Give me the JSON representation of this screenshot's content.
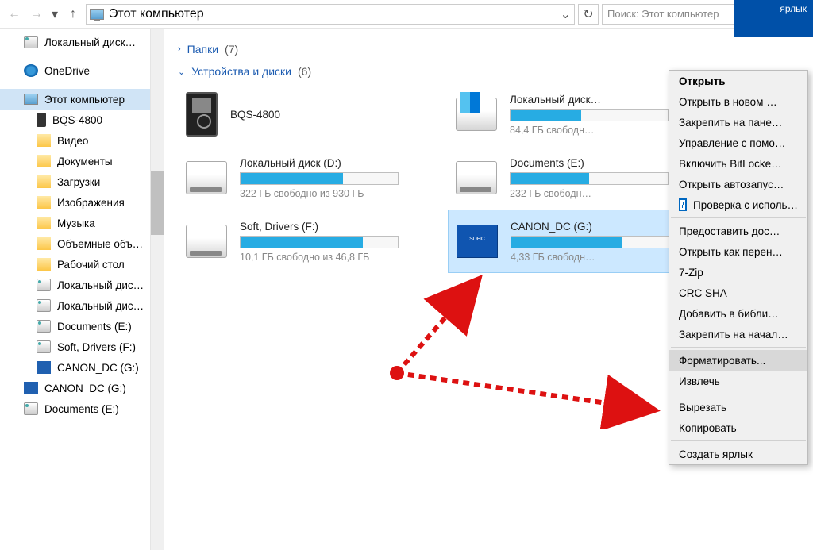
{
  "toolbar": {
    "address": "Этот компьютер",
    "search_placeholder": "Поиск: Этот компьютер"
  },
  "blue_corner": "ярлык",
  "sidebar": {
    "items": [
      {
        "label": "Локальный диск…",
        "icon": "drive",
        "indent": "indent2"
      },
      {
        "label": "OneDrive",
        "icon": "onedrive",
        "indent": ""
      },
      {
        "label": "Этот компьютер",
        "icon": "pc",
        "indent": "",
        "selected": true
      },
      {
        "label": "BQS-4800",
        "icon": "phone",
        "indent": "indent"
      },
      {
        "label": "Видео",
        "icon": "folder",
        "indent": "indent"
      },
      {
        "label": "Документы",
        "icon": "folder",
        "indent": "indent"
      },
      {
        "label": "Загрузки",
        "icon": "folder",
        "indent": "indent"
      },
      {
        "label": "Изображения",
        "icon": "folder",
        "indent": "indent"
      },
      {
        "label": "Музыка",
        "icon": "folder",
        "indent": "indent"
      },
      {
        "label": "Объемные объ…",
        "icon": "folder",
        "indent": "indent"
      },
      {
        "label": "Рабочий стол",
        "icon": "folder",
        "indent": "indent"
      },
      {
        "label": "Локальный дис…",
        "icon": "drive",
        "indent": "indent"
      },
      {
        "label": "Локальный дис…",
        "icon": "drive",
        "indent": "indent"
      },
      {
        "label": "Documents (E:)",
        "icon": "drive",
        "indent": "indent"
      },
      {
        "label": "Soft, Drivers (F:)",
        "icon": "drive",
        "indent": "indent"
      },
      {
        "label": "CANON_DC (G:)",
        "icon": "sd",
        "indent": "indent"
      },
      {
        "label": "CANON_DC (G:)",
        "icon": "sd",
        "indent": ""
      },
      {
        "label": "Documents (E:)",
        "icon": "drive",
        "indent": ""
      }
    ]
  },
  "groups": {
    "folders": {
      "label": "Папки",
      "count": "(7)"
    },
    "drives": {
      "label": "Устройства и диски",
      "count": "(6)"
    }
  },
  "drives": [
    {
      "name": "BQS-4800",
      "sub": "",
      "icon": "mp3",
      "fill": 0
    },
    {
      "name": "Локальный диск…",
      "sub": "84,4 ГБ свободн…",
      "icon": "win",
      "fill": 45
    },
    {
      "name": "Локальный диск (D:)",
      "sub": "322 ГБ свободно из 930 ГБ",
      "icon": "hdd",
      "fill": 65
    },
    {
      "name": "Documents (E:)",
      "sub": "232 ГБ свободн…",
      "icon": "hdd",
      "fill": 50
    },
    {
      "name": "Soft, Drivers (F:)",
      "sub": "10,1 ГБ свободно из 46,8 ГБ",
      "icon": "hdd",
      "fill": 78
    },
    {
      "name": "CANON_DC (G:)",
      "sub": "4,33 ГБ свободн…",
      "icon": "sdhc",
      "fill": 70,
      "selected": true
    }
  ],
  "context_menu": [
    {
      "label": "Открыть",
      "bold": true
    },
    {
      "label": "Открыть в новом …"
    },
    {
      "label": "Закрепить на пане…"
    },
    {
      "label": "Управление с помо…"
    },
    {
      "label": "Включить BitLocke…"
    },
    {
      "label": "Открыть автозапус…"
    },
    {
      "label": "Проверка с исполь…",
      "icon": "shield"
    },
    {
      "sep": true
    },
    {
      "label": "Предоставить дос…"
    },
    {
      "label": "Открыть как перен…"
    },
    {
      "label": "7-Zip"
    },
    {
      "label": "CRC SHA"
    },
    {
      "label": "Добавить в библи…"
    },
    {
      "label": "Закрепить на начал…"
    },
    {
      "sep": true
    },
    {
      "label": "Форматировать...",
      "highlight": true
    },
    {
      "label": "Извлечь"
    },
    {
      "sep": true
    },
    {
      "label": "Вырезать"
    },
    {
      "label": "Копировать"
    },
    {
      "sep": true
    },
    {
      "label": "Создать ярлык"
    }
  ]
}
